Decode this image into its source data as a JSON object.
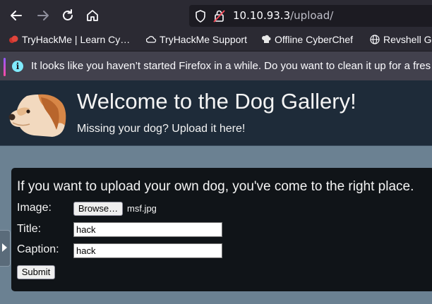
{
  "browser": {
    "url_host": "10.10.93.3",
    "url_path": "/upload/",
    "bookmarks": [
      {
        "label": "TryHackMe | Learn Cy…",
        "icon": "tryhackme-icon"
      },
      {
        "label": "TryHackMe Support",
        "icon": "cloud-icon"
      },
      {
        "label": "Offline CyberChef",
        "icon": "chef-icon"
      },
      {
        "label": "Revshell G",
        "icon": "globe-icon"
      }
    ],
    "notification": "It looks like you haven’t started Firefox in a while. Do you want to clean it up for a fres"
  },
  "header": {
    "title": "Welcome to the Dog Gallery!",
    "subtitle": "Missing your dog? Upload it here!"
  },
  "upload_form": {
    "heading": "If you want to upload your own dog, you've come to the right place.",
    "image_label": "Image:",
    "browse_label": "Browse…",
    "file_name": "msf.jpg",
    "title_label": "Title:",
    "title_value": "hack",
    "caption_label": "Caption:",
    "caption_value": "hack",
    "submit_label": "Submit"
  },
  "colors": {
    "page_background": "#6b8192",
    "header_background": "#1e2b39",
    "panel_background": "#101418",
    "browser_chrome": "#2b2a33"
  }
}
